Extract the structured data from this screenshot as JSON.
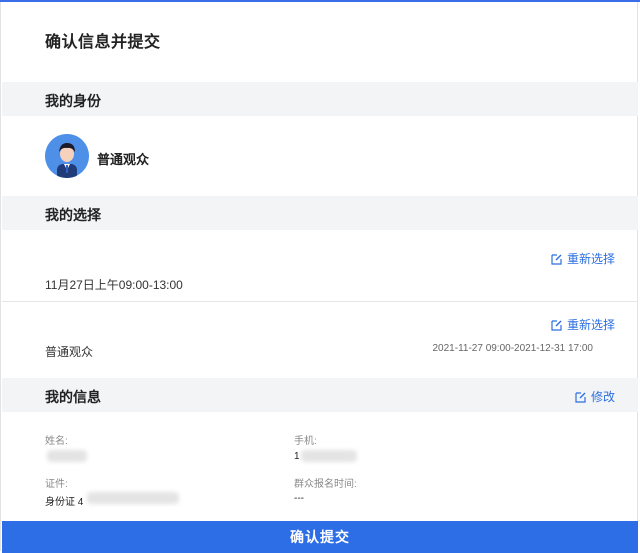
{
  "page": {
    "title": "确认信息并提交"
  },
  "identity_section": {
    "heading": "我的身份",
    "identity_label": "普通观众"
  },
  "choice_section": {
    "heading": "我的选择",
    "items": [
      {
        "reselect_label": "重新选择",
        "text": "11月27日上午09:00-13:00",
        "detail": ""
      },
      {
        "reselect_label": "重新选择",
        "text": "普通观众",
        "detail": "2021-11-27 09:00-2021-12-31 17:00"
      }
    ]
  },
  "info_section": {
    "heading": "我的信息",
    "edit_label": "修改",
    "fields": [
      {
        "label": "姓名:",
        "value": ""
      },
      {
        "label": "手机:",
        "value": "1"
      },
      {
        "label": "证件:",
        "value": "身份证 4"
      },
      {
        "label": "群众报名时间:",
        "value": "---"
      }
    ]
  },
  "submit": {
    "label": "确认提交"
  },
  "colors": {
    "accent": "#2d6de6",
    "link": "#2c6fe0",
    "section_bg": "#f3f4f6"
  }
}
